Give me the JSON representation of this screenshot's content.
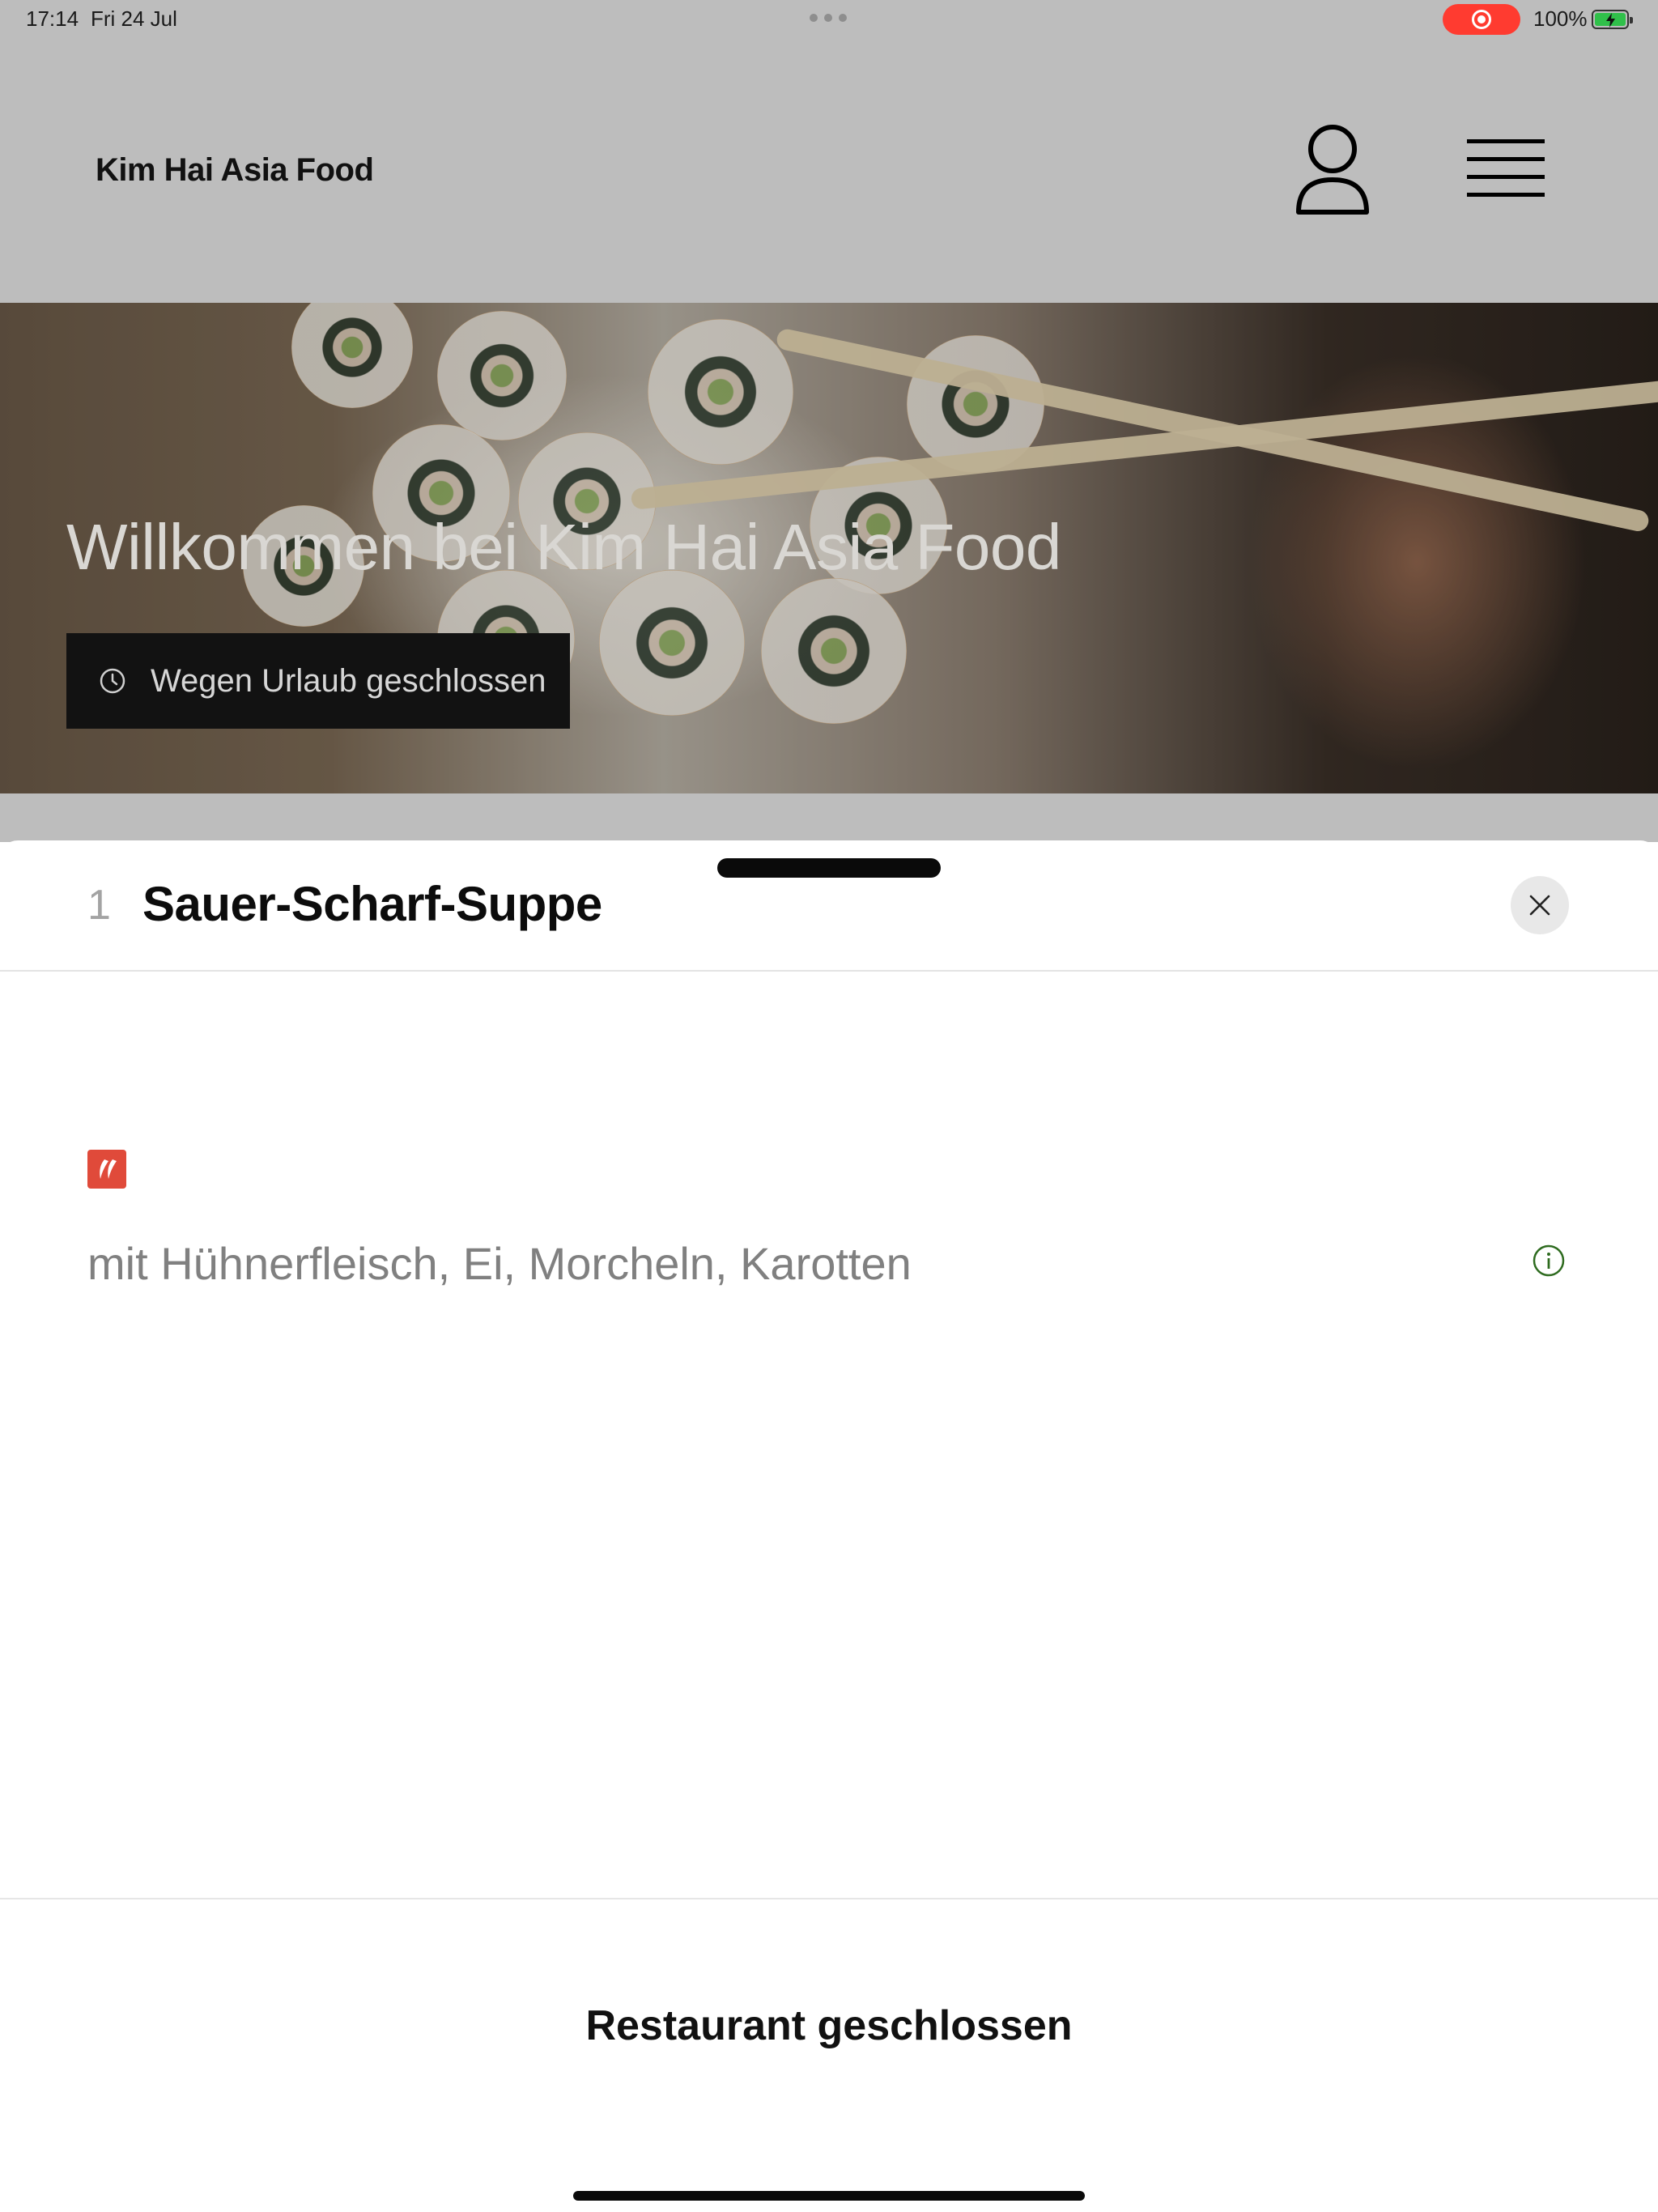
{
  "status_bar": {
    "time": "17:14",
    "date": "Fri 24 Jul",
    "battery": "100%"
  },
  "header": {
    "site_title": "Kim Hai Asia Food",
    "account_icon": "person-icon",
    "menu_icon": "hamburger-menu-icon"
  },
  "hero": {
    "title": "Willkommen bei Kim Hai Asia Food",
    "status_badge": "Wegen Urlaub geschlossen",
    "status_icon": "clock-icon"
  },
  "item_sheet": {
    "number": "1",
    "title": "Sauer-Scharf-Suppe",
    "tag_icon": "spicy-chili-icon",
    "description": "mit Hühnerfleisch, Ei, Morcheln, Karotten",
    "info_icon": "info-icon",
    "footer_status": "Restaurant geschlossen"
  },
  "colors": {
    "background_dim": "#bdbdbd",
    "badge_bg": "#121212",
    "spicy_tag": "#e04a3a",
    "info_icon": "#2e6b1f",
    "recording": "#ff3b30"
  }
}
